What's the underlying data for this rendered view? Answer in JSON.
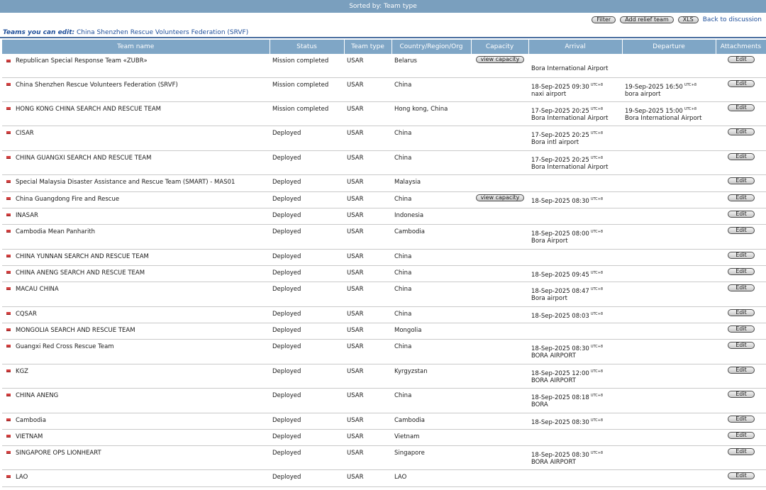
{
  "sort_label": "Sorted by: Team type",
  "toolbar": {
    "filter": "Filter",
    "add": "Add relief team",
    "xls": "XLS",
    "back": "Back to discussion"
  },
  "edit_label": "Teams you can edit:",
  "edit_team": "China Shenzhen Rescue Volunteers Federation (SRVF)",
  "columns": [
    "Team name",
    "Status",
    "Team type",
    "Country/Region/Org",
    "Capacity",
    "Arrival",
    "Departure",
    "Attachments"
  ],
  "capacity_label": "view capacity",
  "edit_button": "Edit",
  "utc_tag": "UTC+8",
  "flag_icon": "flag-icon",
  "rows": [
    {
      "name": "Republican Special Response Team «ZUBR»",
      "status": "Mission completed",
      "type": "USAR",
      "country": "Belarus",
      "capacity": true,
      "arr_time": "",
      "arr_place": "Bora International Airport",
      "dep_time": "",
      "dep_place": "",
      "h": 33
    },
    {
      "name": "China Shenzhen Rescue Volunteers Federation (SRVF)",
      "status": "Mission completed",
      "type": "USAR",
      "country": "China",
      "capacity": false,
      "arr_time": "18-Sep-2025 09:30",
      "arr_place": "naxi airport",
      "dep_time": "19-Sep-2025 16:50",
      "dep_place": "bora airport",
      "h": 34
    },
    {
      "name": "HONG KONG CHINA SEARCH AND RESCUE TEAM",
      "status": "Mission completed",
      "type": "USAR",
      "country": "Hong kong, China",
      "capacity": false,
      "arr_time": "17-Sep-2025 20:25",
      "arr_place": "Bora International Airport",
      "dep_time": "19-Sep-2025 15:00",
      "dep_place": "Bora International Airport",
      "h": 34
    },
    {
      "name": "CISAR",
      "status": "Deployed",
      "type": "USAR",
      "country": "China",
      "capacity": false,
      "arr_time": "17-Sep-2025 20:25",
      "arr_place": "Bora intl airport",
      "dep_time": "",
      "dep_place": "",
      "h": 35
    },
    {
      "name": "CHINA GUANGXI SEARCH AND RESCUE TEAM",
      "status": "Deployed",
      "type": "USAR",
      "country": "China",
      "capacity": false,
      "arr_time": "17-Sep-2025 20:25",
      "arr_place": "Bora International Airport",
      "dep_time": "",
      "dep_place": "",
      "h": 34
    },
    {
      "name": "Special Malaysia Disaster Assistance and Rescue Team (SMART) - MAS01",
      "status": "Deployed",
      "type": "USAR",
      "country": "Malaysia",
      "capacity": false,
      "arr_time": "",
      "arr_place": "",
      "dep_time": "",
      "dep_place": "",
      "h": 24
    },
    {
      "name": "China Guangdong Fire and Rescue",
      "status": "Deployed",
      "type": "USAR",
      "country": "China",
      "capacity": true,
      "arr_time": "18-Sep-2025 08:30",
      "arr_place": "",
      "dep_time": "",
      "dep_place": "",
      "h": 23
    },
    {
      "name": "INASAR",
      "status": "Deployed",
      "type": "USAR",
      "country": "Indonesia",
      "capacity": false,
      "arr_time": "",
      "arr_place": "",
      "dep_time": "",
      "dep_place": "",
      "h": 23
    },
    {
      "name": "Cambodia Mean Panharith",
      "status": "Deployed",
      "type": "USAR",
      "country": "Cambodia",
      "capacity": false,
      "arr_time": "18-Sep-2025 08:00",
      "arr_place": "Bora Airport",
      "dep_time": "",
      "dep_place": "",
      "h": 35
    },
    {
      "name": "CHINA YUNNAN SEARCH AND RESCUE TEAM",
      "status": "Deployed",
      "type": "USAR",
      "country": "China",
      "capacity": false,
      "arr_time": "",
      "arr_place": "",
      "dep_time": "",
      "dep_place": "",
      "h": 23
    },
    {
      "name": "CHINA ANENG SEARCH AND RESCUE TEAM",
      "status": "Deployed",
      "type": "USAR",
      "country": "China",
      "capacity": false,
      "arr_time": "18-Sep-2025 09:45",
      "arr_place": "",
      "dep_time": "",
      "dep_place": "",
      "h": 23
    },
    {
      "name": "MACAU CHINA",
      "status": "Deployed",
      "type": "USAR",
      "country": "China",
      "capacity": false,
      "arr_time": "18-Sep-2025 08:47",
      "arr_place": "Bora airport",
      "dep_time": "",
      "dep_place": "",
      "h": 35
    },
    {
      "name": "CQSAR",
      "status": "Deployed",
      "type": "USAR",
      "country": "China",
      "capacity": false,
      "arr_time": "18-Sep-2025 08:03",
      "arr_place": "",
      "dep_time": "",
      "dep_place": "",
      "h": 23
    },
    {
      "name": "MONGOLIA SEARCH AND RESCUE TEAM",
      "status": "Deployed",
      "type": "USAR",
      "country": "Mongolia",
      "capacity": false,
      "arr_time": "",
      "arr_place": "",
      "dep_time": "",
      "dep_place": "",
      "h": 23
    },
    {
      "name": "Guangxi Red Cross Rescue Team",
      "status": "Deployed",
      "type": "USAR",
      "country": "China",
      "capacity": false,
      "arr_time": "18-Sep-2025 08:30",
      "arr_place": "BORA AIRPORT",
      "dep_time": "",
      "dep_place": "",
      "h": 35
    },
    {
      "name": "KGZ",
      "status": "Deployed",
      "type": "USAR",
      "country": "Kyrgyzstan",
      "capacity": false,
      "arr_time": "18-Sep-2025 12:00",
      "arr_place": "BORA AIRPORT",
      "dep_time": "",
      "dep_place": "",
      "h": 34
    },
    {
      "name": "CHINA ANENG",
      "status": "Deployed",
      "type": "USAR",
      "country": "China",
      "capacity": false,
      "arr_time": "18-Sep-2025 08:18",
      "arr_place": "BORA",
      "dep_time": "",
      "dep_place": "",
      "h": 35
    },
    {
      "name": "Cambodia",
      "status": "Deployed",
      "type": "USAR",
      "country": "Cambodia",
      "capacity": false,
      "arr_time": "18-Sep-2025 08:30",
      "arr_place": "",
      "dep_time": "",
      "dep_place": "",
      "h": 23
    },
    {
      "name": "VIETNAM",
      "status": "Deployed",
      "type": "USAR",
      "country": "Vietnam",
      "capacity": false,
      "arr_time": "",
      "arr_place": "",
      "dep_time": "",
      "dep_place": "",
      "h": 23
    },
    {
      "name": "SINGAPORE OPS LIONHEART",
      "status": "Deployed",
      "type": "USAR",
      "country": "Singapore",
      "capacity": false,
      "arr_time": "18-Sep-2025 08:30",
      "arr_place": "BORA AIRPORT",
      "dep_time": "",
      "dep_place": "",
      "h": 34
    },
    {
      "name": "LAO",
      "status": "Deployed",
      "type": "USAR",
      "country": "LAO",
      "capacity": false,
      "arr_time": "",
      "arr_place": "",
      "dep_time": "",
      "dep_place": "",
      "h": 24
    }
  ]
}
